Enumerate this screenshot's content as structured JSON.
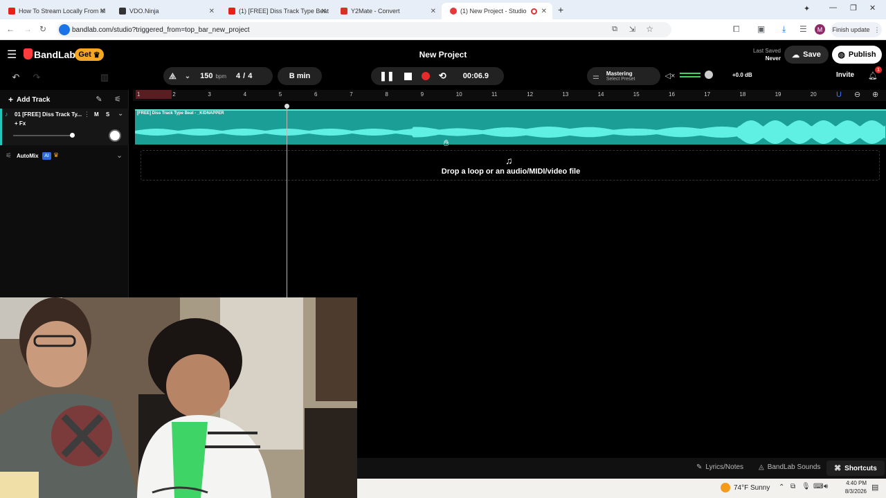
{
  "browser": {
    "tabs": [
      {
        "title": "How To Stream Locally From M",
        "color": "#e62117"
      },
      {
        "title": "VDO.Ninja",
        "color": "#333333"
      },
      {
        "title": "(1) [FREE] Diss Track Type Beat",
        "color": "#e62117"
      },
      {
        "title": "Y2Mate - Convert",
        "color": "#d93025"
      },
      {
        "title": "(1) New Project - Studio",
        "color": "#e5383b"
      }
    ],
    "url": "bandlab.com/studio?triggered_from=top_bar_new_project",
    "finish_update": "Finish update",
    "profile_initial": "M"
  },
  "app": {
    "brand": "BandLab",
    "get_label": "Get",
    "project_title": "New Project",
    "last_saved_label": "Last Saved",
    "last_saved_value": "Never",
    "save_label": "Save",
    "publish_label": "Publish",
    "invite_label": "Invite",
    "notification_count": "1"
  },
  "toolbar": {
    "tempo": "150",
    "tempo_unit": "bpm",
    "time_sig_top": "4",
    "time_sig_sep": "/",
    "time_sig_bottom": "4",
    "key": "B min",
    "time": "00:06.9",
    "mastering_label": "Mastering",
    "mastering_preset": "Select Preset",
    "volume_db": "+0.0 dB"
  },
  "tracks": {
    "add_track": "Add Track",
    "name": "01  [FREE] Diss Track Ty...",
    "mute": "M",
    "solo": "S",
    "fx": "+ Fx",
    "automix": "AutoMix",
    "ai_badge": "AI"
  },
  "timeline": {
    "bars": [
      "1",
      "2",
      "3",
      "4",
      "5",
      "6",
      "7",
      "8",
      "9",
      "10",
      "11",
      "12",
      "13",
      "14",
      "15",
      "16",
      "17",
      "18",
      "19",
      "20"
    ],
    "clip_name": "[FREE] Diss Track Type Beat - _KIDNAPPER",
    "drop_hint": "Drop a loop or an audio/MIDI/video file",
    "track_color": "#1a9e95"
  },
  "bottom": {
    "lyrics": "Lyrics/Notes",
    "sounds": "BandLab Sounds",
    "shortcuts": "Shortcuts"
  },
  "taskbar": {
    "weather": "74°F  Sunny",
    "time": "4:40 PM",
    "date": "8/3/2026"
  }
}
